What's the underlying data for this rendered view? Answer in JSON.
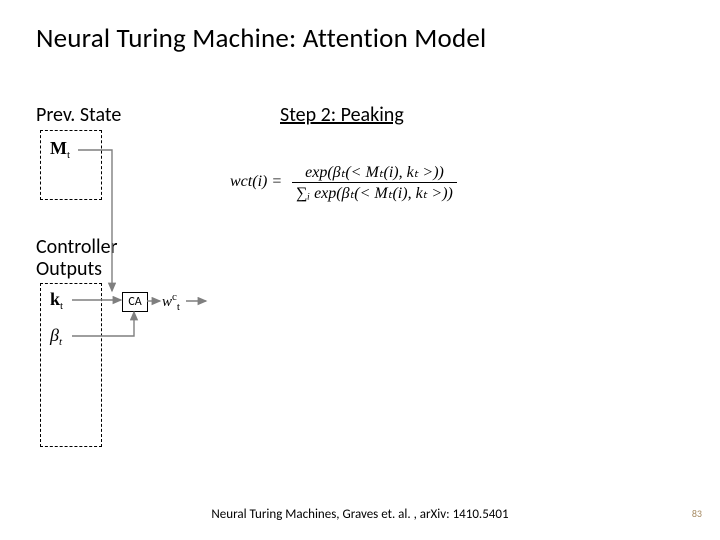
{
  "title": "Neural Turing Machine: Attention Model",
  "prev_state_label": "Prev. State",
  "controller_label_l1": "Controller",
  "controller_label_l2": "Outputs",
  "step_label": "Step 2: Peaking",
  "symbols": {
    "M": "M",
    "M_sub": "t",
    "k": "k",
    "k_sub": "t",
    "beta": "β",
    "beta_sub": "t",
    "w": "w",
    "w_sub": "t",
    "w_sup": "c"
  },
  "ca_label": "CA",
  "equation": {
    "lhs_w": "w",
    "lhs_sub": "t",
    "lhs_sup": "c",
    "lhs_arg": "(i) =",
    "num": "exp(βₜ(< Mₜ(i), kₜ >))",
    "den": "∑ᵢ exp(βₜ(< Mₜ(i), kₜ >))"
  },
  "citation": "Neural Turing Machines, Graves et. al. , arXiv: 1410.5401",
  "page_number": "83"
}
